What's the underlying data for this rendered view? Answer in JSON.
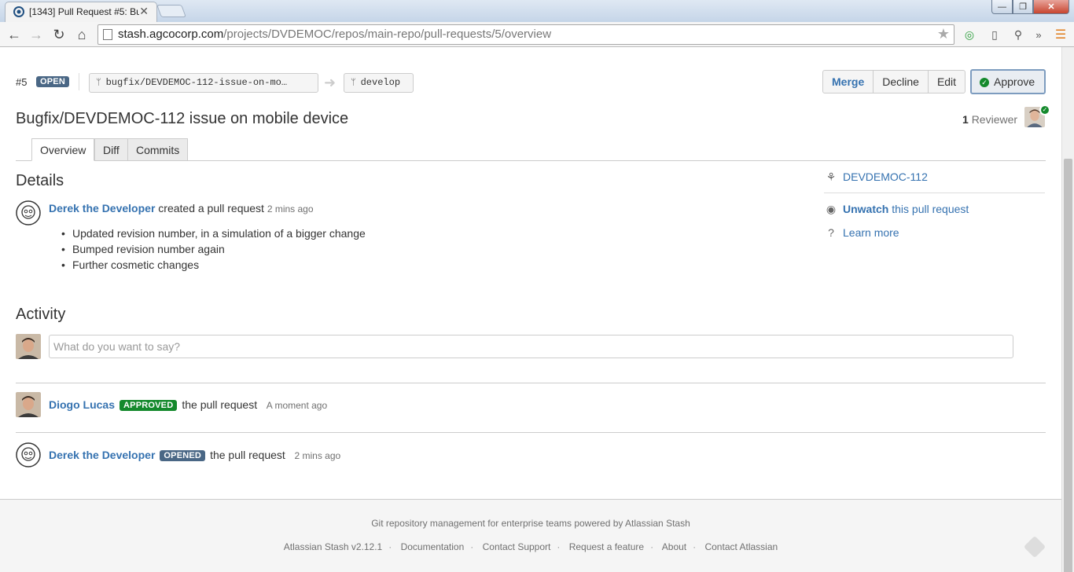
{
  "browser": {
    "tab_title": "[1343] Pull Request #5: Bu",
    "tab_close": "✕",
    "url_host": "stash.agcocorp.com",
    "url_path": "/projects/DVDEMOC/repos/main-repo/pull-requests/5/overview"
  },
  "pr": {
    "id": "#5",
    "state": "OPEN",
    "source_branch": "bugfix/DEVDEMOC-112-issue-on-mo…",
    "target_branch": "develop",
    "title": "Bugfix/DEVDEMOC-112 issue on mobile device",
    "reviewer_count": "1",
    "reviewer_label": "Reviewer"
  },
  "actions": {
    "merge": "Merge",
    "decline": "Decline",
    "edit": "Edit",
    "approve": "Approve"
  },
  "tabs": [
    "Overview",
    "Diff",
    "Commits"
  ],
  "details": {
    "heading": "Details",
    "author": "Derek the Developer",
    "action": "created a pull request",
    "time": "2 mins ago",
    "items": [
      "Updated revision number, in a simulation of a bigger change",
      "Bumped revision number again",
      "Further cosmetic changes"
    ]
  },
  "activity": {
    "heading": "Activity",
    "comment_placeholder": "What do you want to say?",
    "events": [
      {
        "user": "Diogo Lucas",
        "badge": "APPROVED",
        "text": "the pull request",
        "time": "A moment ago"
      },
      {
        "user": "Derek the Developer",
        "badge": "OPENED",
        "text": "the pull request",
        "time": "2 mins ago"
      }
    ]
  },
  "sidebar": {
    "issue": "DEVDEMOC-112",
    "unwatch_bold": "Unwatch",
    "unwatch_rest": "this pull request",
    "learn_more": "Learn more"
  },
  "footer": {
    "tagline": "Git repository management for enterprise teams powered by Atlassian Stash",
    "links": [
      "Atlassian Stash v2.12.1",
      "Documentation",
      "Contact Support",
      "Request a feature",
      "About",
      "Contact Atlassian"
    ]
  },
  "colors": {
    "link": "#3572b0",
    "approved": "#14892c",
    "open": "#4a6785"
  }
}
